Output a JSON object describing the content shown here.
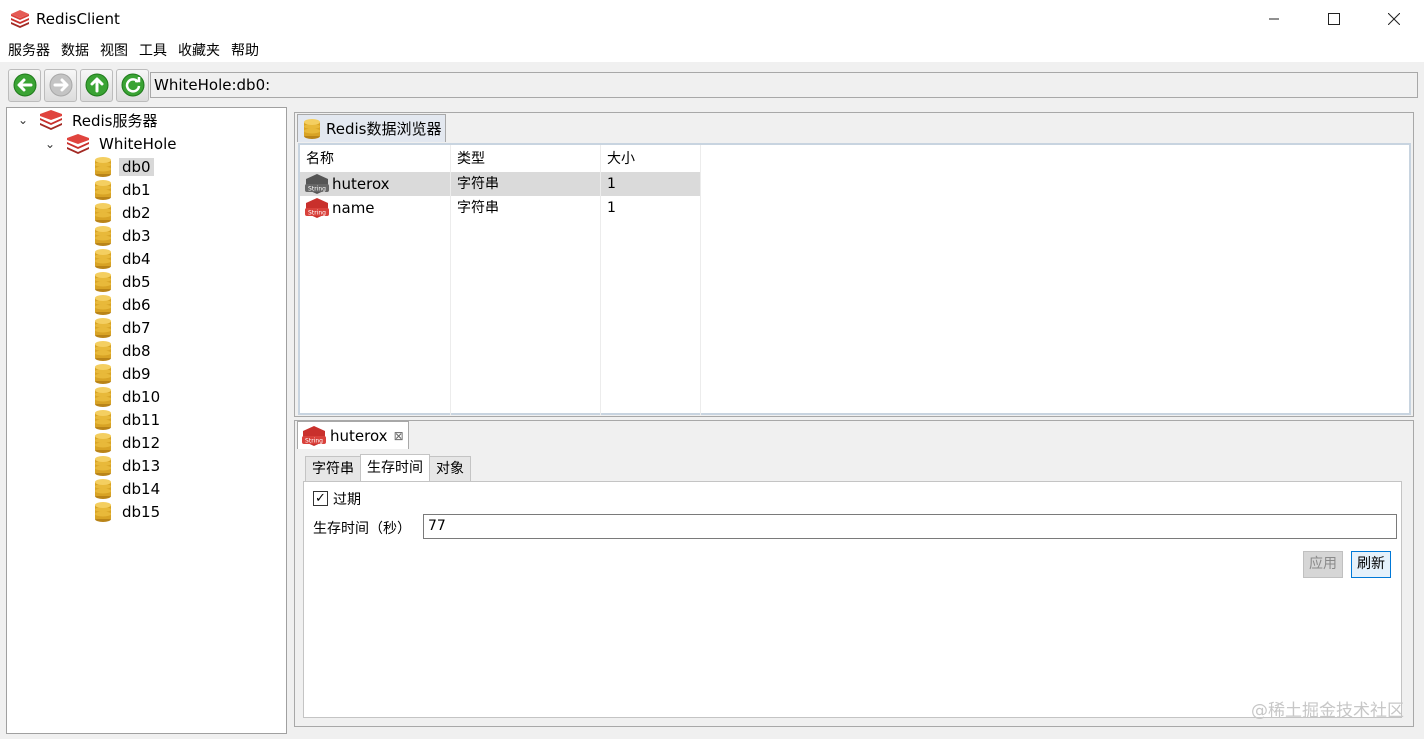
{
  "window": {
    "title": "RedisClient"
  },
  "menubar": {
    "items": [
      "服务器",
      "数据",
      "视图",
      "工具",
      "收藏夹",
      "帮助"
    ]
  },
  "toolbar": {
    "address": "WhiteHole:db0:"
  },
  "tree": {
    "root": "Redis服务器",
    "server": "WhiteHole",
    "dbs": [
      "db0",
      "db1",
      "db2",
      "db3",
      "db4",
      "db5",
      "db6",
      "db7",
      "db8",
      "db9",
      "db10",
      "db11",
      "db12",
      "db13",
      "db14",
      "db15"
    ],
    "selected": "db0"
  },
  "browser": {
    "tab_label": "Redis数据浏览器",
    "columns": [
      "名称",
      "类型",
      "大小"
    ],
    "rows": [
      {
        "name": "huterox",
        "type": "字符串",
        "size": "1"
      },
      {
        "name": "name",
        "type": "字符串",
        "size": "1"
      }
    ]
  },
  "detail": {
    "tab_label": "huterox",
    "close_glyph": "⊠",
    "subtabs": [
      "字符串",
      "生存时间",
      "对象"
    ],
    "active_subtab": "生存时间",
    "expire_label": "过期",
    "expire_checked": true,
    "ttl_label": "生存时间（秒）",
    "ttl_value": "77",
    "apply_label": "应用",
    "refresh_label": "刷新"
  },
  "watermark": "@稀土掘金技术社区",
  "colors": {
    "redis_red": "#c9302c",
    "db_gold": "#d8a325",
    "nav_green": "#3aa334"
  }
}
